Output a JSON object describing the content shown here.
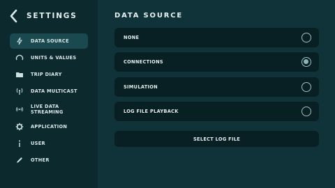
{
  "sidebar": {
    "title": "SETTINGS",
    "items": [
      {
        "label": "DATA SOURCE",
        "icon": "lightning-icon"
      },
      {
        "label": "UNITS & VALUES",
        "icon": "gauge-icon"
      },
      {
        "label": "TRIP DIARY",
        "icon": "folder-icon"
      },
      {
        "label": "DATA MULTICAST",
        "icon": "broadcast-icon"
      },
      {
        "label": "LIVE DATA\nSTREAMING",
        "icon": "streaming-icon"
      },
      {
        "label": "APPLICATION",
        "icon": "gear-icon"
      },
      {
        "label": "USER",
        "icon": "info-icon"
      },
      {
        "label": "OTHER",
        "icon": "pencil-icon"
      }
    ],
    "active_index": 0
  },
  "main": {
    "title": "DATA SOURCE",
    "options": [
      {
        "label": "NONE",
        "selected": false
      },
      {
        "label": "CONNECTIONS",
        "selected": true
      },
      {
        "label": "SIMULATION",
        "selected": false
      },
      {
        "label": "LOG FILE PLAYBACK",
        "selected": false
      }
    ],
    "select_button": "SELECT LOG FILE"
  },
  "colors": {
    "background": "#0f3338",
    "sidebar": "#0c2a2e",
    "active_item": "#1a4a50",
    "row": "#082024",
    "radio": "#9fc0c4"
  }
}
